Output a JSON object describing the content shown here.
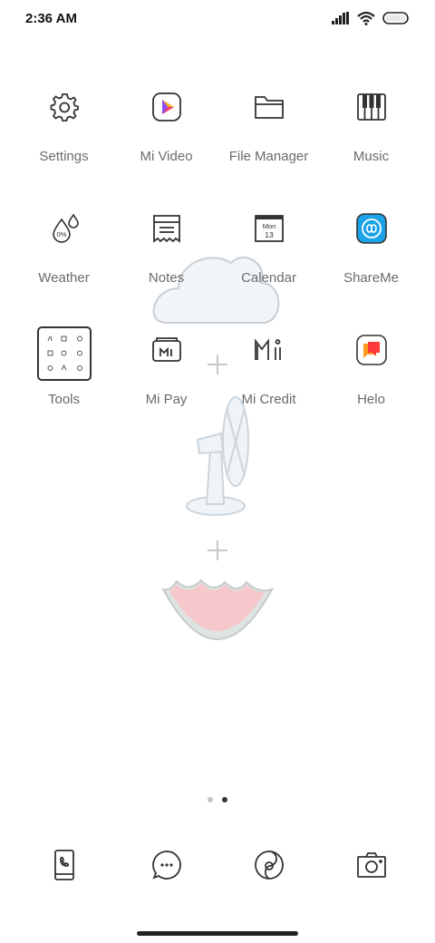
{
  "status_bar": {
    "time": "2:36 AM",
    "icons": [
      "signal-icon",
      "wifi-icon",
      "battery-icon"
    ]
  },
  "apps": [
    {
      "label": "Settings",
      "icon": "gear-icon"
    },
    {
      "label": "Mi Video",
      "icon": "mi-video-icon"
    },
    {
      "label": "File Manager",
      "icon": "folder-icon"
    },
    {
      "label": "Music",
      "icon": "piano-icon"
    },
    {
      "label": "Weather",
      "icon": "weather-drops-icon"
    },
    {
      "label": "Notes",
      "icon": "notes-icon"
    },
    {
      "label": "Calendar",
      "icon": "calendar-icon",
      "calendar_day": "Mon",
      "calendar_date": "13"
    },
    {
      "label": "ShareMe",
      "icon": "shareme-icon"
    },
    {
      "label": "Tools",
      "icon": "tools-folder-icon"
    },
    {
      "label": "Mi Pay",
      "icon": "wallet-icon"
    },
    {
      "label": "Mi Credit",
      "icon": "mi-logo-icon"
    },
    {
      "label": "Helo",
      "icon": "helo-icon"
    }
  ],
  "weather_icon_text": "0%",
  "page_indicator": {
    "count": 2,
    "active": 2
  },
  "dock": [
    {
      "icon": "phone-icon"
    },
    {
      "icon": "messages-icon"
    },
    {
      "icon": "browser-icon"
    },
    {
      "icon": "camera-icon"
    }
  ],
  "colors": {
    "label": "#6b6b6b",
    "shareme_blue": "#1aa3e8",
    "helo_orange": "#ff5a1f",
    "watermelon_pink": "#f6c7cb"
  }
}
